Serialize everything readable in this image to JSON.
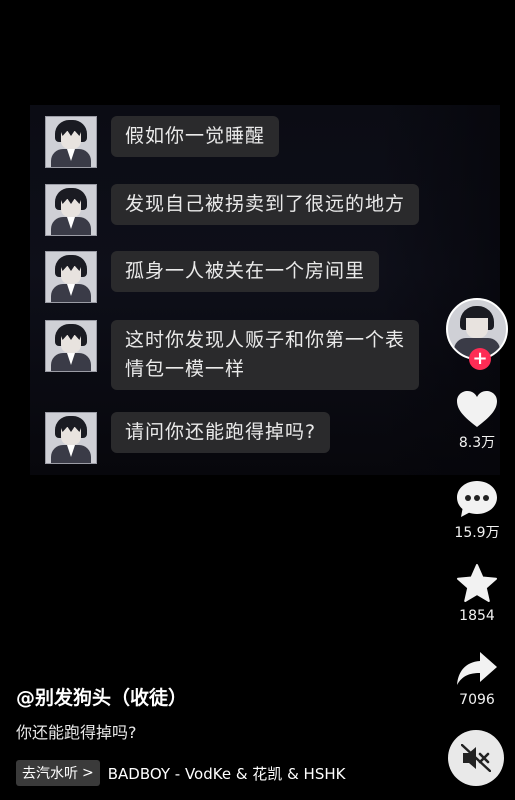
{
  "video": {
    "messages": [
      {
        "text": "假如你一觉睡醒"
      },
      {
        "text": "发现自己被拐卖到了很远的地方"
      },
      {
        "text": "孤身一人被关在一个房间里"
      },
      {
        "text": "这时你发现人贩子和你第一个表\n情包一模一样"
      },
      {
        "text": "请问你还能跑得掉吗?"
      }
    ]
  },
  "sidebar": {
    "follow_symbol": "+",
    "like_count": "8.3万",
    "comment_count": "15.9万",
    "favorite_count": "1854",
    "share_count": "7096"
  },
  "post": {
    "author": "@别发狗头（收徒）",
    "caption": "你还能跑得掉吗?"
  },
  "music": {
    "tag": "去汽水听",
    "tag_chevron": ">",
    "song": "BADBOY - VodKe & 花凯 & HSHK"
  },
  "colors": {
    "accent": "#fe2c55",
    "bubble": "#2a2a2c",
    "background": "#000000"
  },
  "icons": [
    "heart-icon",
    "comment-icon",
    "star-icon",
    "share-icon",
    "mute-icon"
  ]
}
